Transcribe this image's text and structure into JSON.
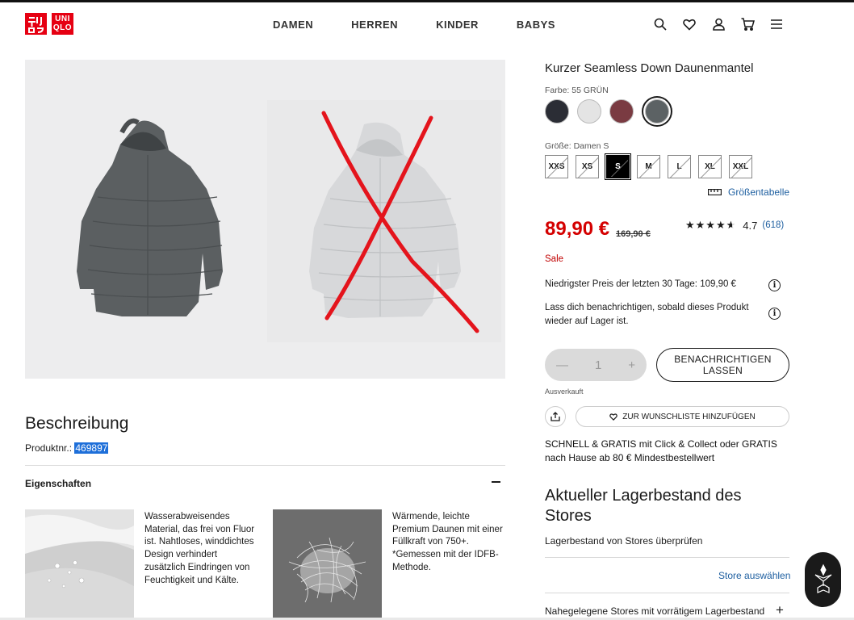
{
  "brand": {
    "logo_left": "UNI QLO",
    "logo_right": "UNI QLO",
    "logo_left_top": "ユニ",
    "logo_left_bottom": "クロ",
    "logo_right_top": "UNI",
    "logo_right_bottom": "QLO"
  },
  "nav": {
    "items": [
      "DAMEN",
      "HERREN",
      "KINDER",
      "BABYS"
    ]
  },
  "header_icons": [
    "search-icon",
    "heart-icon",
    "account-icon",
    "cart-icon",
    "menu-icon"
  ],
  "product": {
    "name": "Kurzer Seamless Down Daunenmantel",
    "color_label": "Farbe: 55 GRÜN",
    "colors": [
      "#2b2d35",
      "#e4e4e4",
      "#7a3b42",
      "#5c6264"
    ],
    "selected_color_index": 3,
    "size_label": "Größe: Damen S",
    "sizes": [
      "XXS",
      "XS",
      "S",
      "M",
      "L",
      "XL",
      "XXL"
    ],
    "selected_size": "S",
    "size_chart": "Größentabelle",
    "price": "89,90 €",
    "old_price": "169,90 €",
    "rating_stars": 4.7,
    "rating_value": "4.7",
    "rating_count": "(618)",
    "sale": "Sale",
    "lowest_price": "Niedrigster Preis der letzten 30 Tage: 109,90 €",
    "notify_text": "Lass dich benachrichtigen, sobald dieses Produkt wieder auf Lager ist.",
    "quantity": "1",
    "notify_button": "BENACHRICHTIGEN LASSEN",
    "sold_out": "Ausverkauft",
    "wishlist_button": "ZUR WUNSCHLISTE HINZUFÜGEN",
    "shipping_info": "SCHNELL & GRATIS mit Click & Collect oder GRATIS nach Hause ab 80 € Mindestbestellwert"
  },
  "description": {
    "title": "Beschreibung",
    "prodnr_label": "Produktnr.:",
    "prodnr": "469897",
    "properties_title": "Eigenschaften",
    "features": [
      {
        "text": "Wasserabweisendes Material, das frei von Fluor ist. Nahtloses, winddichtes Design verhindert zusätzlich Eindringen von Feuchtigkeit und Kälte."
      },
      {
        "text": "Wärmende, leichte Premium Daunen mit einer Füllkraft von 750+. *Gemessen mit der IDFB-Methode."
      }
    ]
  },
  "stores": {
    "title": "Aktueller Lagerbestand des Stores",
    "check": "Lagerbestand von Stores überprüfen",
    "select": "Store auswählen",
    "nearby": "Nahegelegene Stores mit vorrätigem Lagerbestand"
  }
}
